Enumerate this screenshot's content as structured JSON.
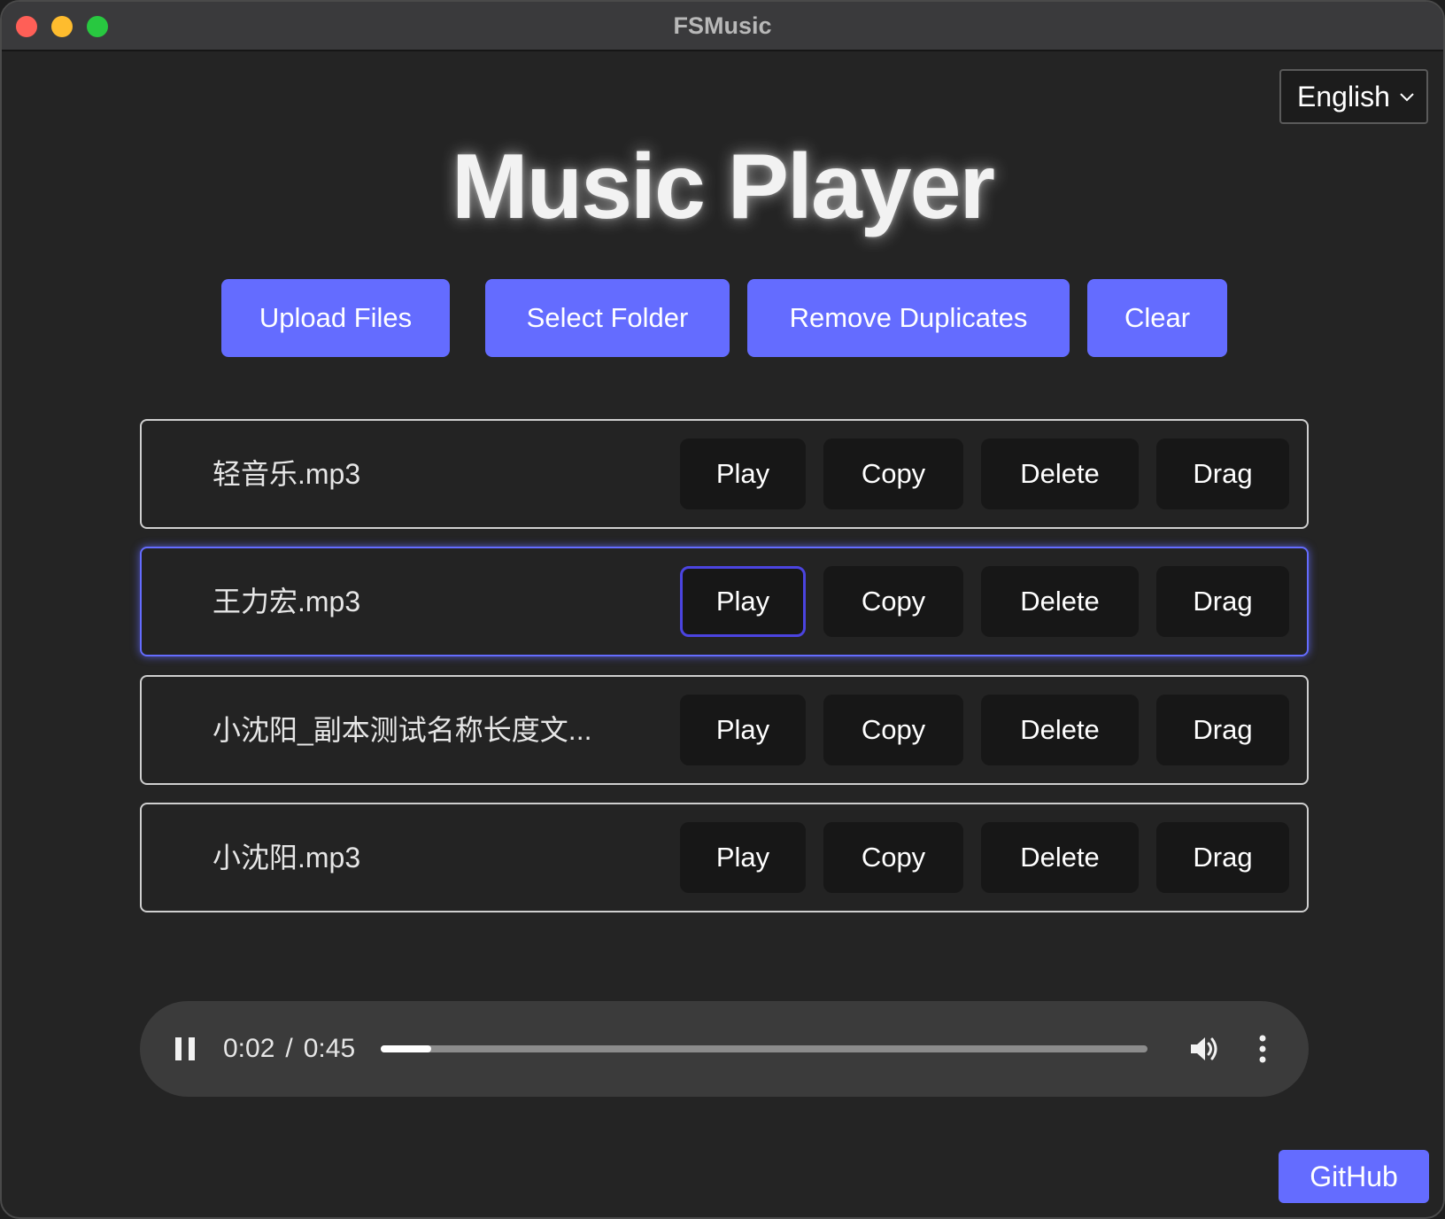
{
  "window": {
    "title": "FSMusic"
  },
  "language": {
    "selected": "English"
  },
  "page": {
    "title": "Music Player"
  },
  "toolbar": {
    "upload_label": "Upload Files",
    "folder_label": "Select Folder",
    "dedupe_label": "Remove Duplicates",
    "clear_label": "Clear"
  },
  "songs": [
    {
      "name": "轻音乐.mp3",
      "play": "Play",
      "copy": "Copy",
      "delete": "Delete",
      "drag": "Drag"
    },
    {
      "name": "王力宏.mp3",
      "play": "Play",
      "copy": "Copy",
      "delete": "Delete",
      "drag": "Drag"
    },
    {
      "name": "小沈阳_副本测试名称长度文...",
      "play": "Play",
      "copy": "Copy",
      "delete": "Delete",
      "drag": "Drag"
    },
    {
      "name": "小沈阳.mp3",
      "play": "Play",
      "copy": "Copy",
      "delete": "Delete",
      "drag": "Drag"
    }
  ],
  "player": {
    "current_time": "0:02",
    "separator": "/",
    "duration": "0:45",
    "progress": 0.066,
    "play_state": "pause-icon",
    "volume_icon": "volume-icon",
    "menu_icon": "more-vertical-icon"
  },
  "footer": {
    "github_label": "GitHub"
  },
  "colors": {
    "accent": "#646cff",
    "background": "#242424",
    "row_button": "#171717"
  }
}
